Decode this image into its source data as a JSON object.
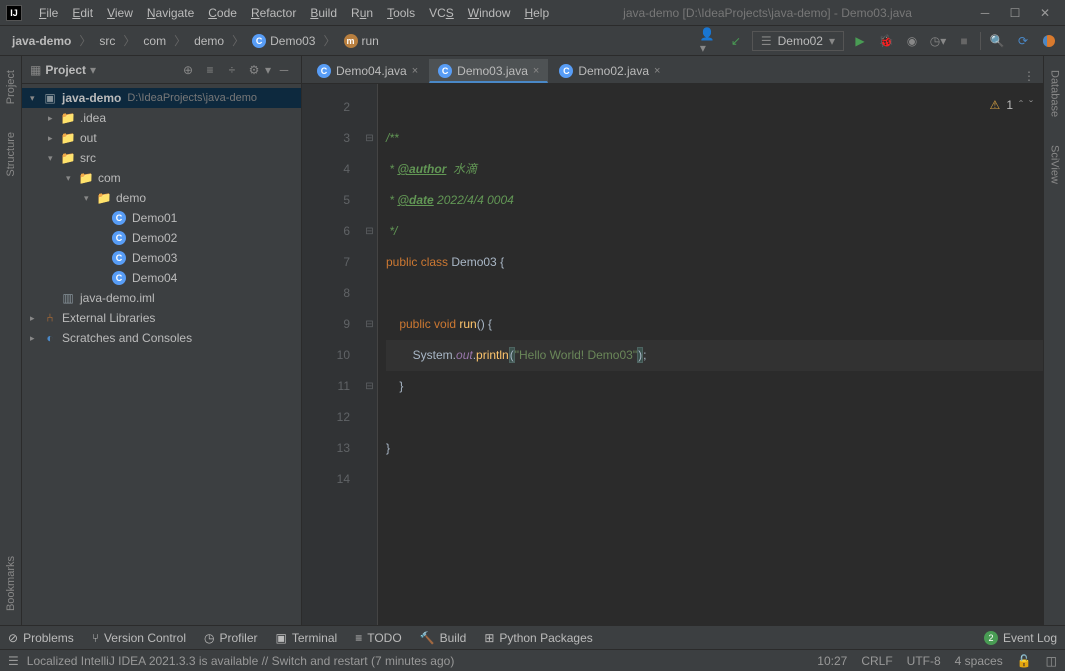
{
  "menu": {
    "file": "File",
    "edit": "Edit",
    "view": "View",
    "navigate": "Navigate",
    "code": "Code",
    "refactor": "Refactor",
    "build": "Build",
    "run": "Run",
    "tools": "Tools",
    "vcs": "VCS",
    "window": "Window",
    "help": "Help"
  },
  "title": "java-demo [D:\\IdeaProjects\\java-demo] - Demo03.java",
  "breadcrumbs": {
    "b0": "java-demo",
    "b1": "src",
    "b2": "com",
    "b3": "demo",
    "b4": "Demo03",
    "b5": "run"
  },
  "run_config": "Demo02",
  "left_tabs": {
    "project": "Project",
    "structure": "Structure",
    "bookmarks": "Bookmarks"
  },
  "right_tabs": {
    "database": "Database",
    "sciview": "SciView"
  },
  "project_panel": {
    "title": "Project"
  },
  "tree": {
    "root": "java-demo",
    "root_path": "D:\\IdeaProjects\\java-demo",
    "idea": ".idea",
    "out": "out",
    "src": "src",
    "com": "com",
    "demo": "demo",
    "d1": "Demo01",
    "d2": "Demo02",
    "d3": "Demo03",
    "d4": "Demo04",
    "iml": "java-demo.iml",
    "ext": "External Libraries",
    "scratch": "Scratches and Consoles"
  },
  "tabs": {
    "t1": "Demo04.java",
    "t2": "Demo03.java",
    "t3": "Demo02.java"
  },
  "code": {
    "l3": "/**",
    "l4a": " * ",
    "l4tag": "@author",
    "l4b": "  水滴",
    "l5a": " * ",
    "l5tag": "@date",
    "l5b": " 2022/4/4 0004",
    "l6": " */",
    "l7a": "public ",
    "l7b": "class ",
    "l7c": "Demo03 {",
    "l9a": "    public ",
    "l9b": "void ",
    "l9c": "run",
    "l9d": "() {",
    "l10a": "        System.",
    "l10b": "out",
    "l10c": ".",
    "l10d": "println",
    "l10e": "(",
    "l10f": "\"Hello World! Demo03\"",
    "l10g": ")",
    "l10h": ";",
    "l11": "    }",
    "l13": "}"
  },
  "inspect": {
    "warn": "1"
  },
  "bottom": {
    "problems": "Problems",
    "vcs": "Version Control",
    "profiler": "Profiler",
    "terminal": "Terminal",
    "todo": "TODO",
    "build": "Build",
    "python": "Python Packages",
    "eventlog": "Event Log",
    "badge": "2"
  },
  "status": {
    "msg": "Localized IntelliJ IDEA 2021.3.3 is available // Switch and restart (7 minutes ago)",
    "pos": "10:27",
    "crlf": "CRLF",
    "enc": "UTF-8",
    "indent": "4 spaces"
  }
}
